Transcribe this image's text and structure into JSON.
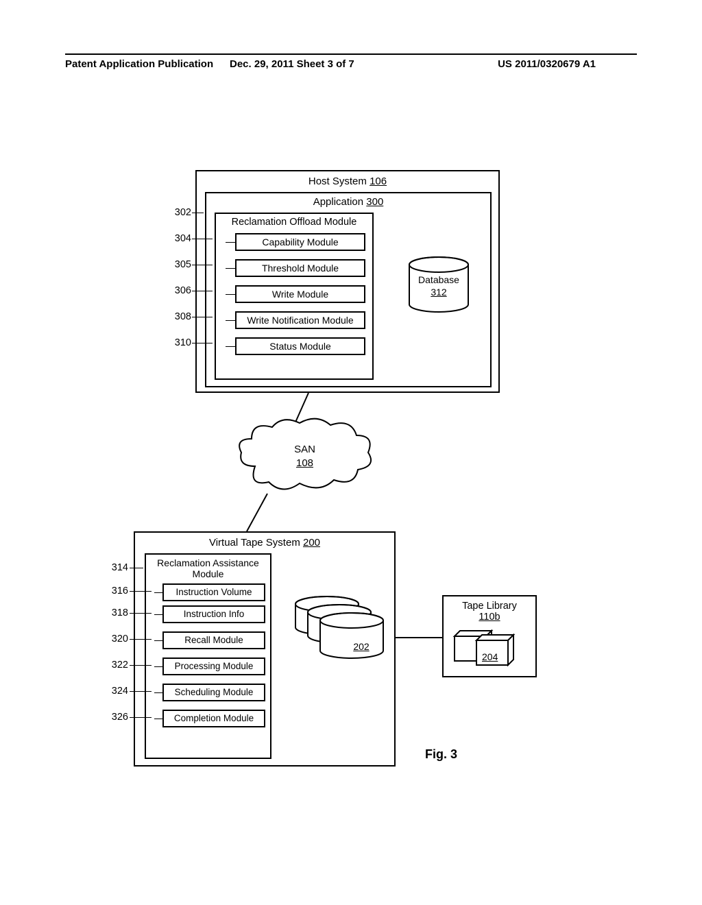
{
  "header": {
    "left": "Patent Application Publication",
    "center": "Dec. 29, 2011  Sheet 3 of 7",
    "right": "US 2011/0320679 A1"
  },
  "host": {
    "title": "Host System",
    "title_ref": "106",
    "app_title": "Application",
    "app_ref": "300",
    "offload_title": "Reclamation Offload Module",
    "offload_ref": "302",
    "modules": {
      "capability": {
        "label": "Capability Module",
        "ref": "304"
      },
      "threshold": {
        "label": "Threshold Module",
        "ref": "305"
      },
      "write": {
        "label": "Write Module",
        "ref": "306"
      },
      "write_notif": {
        "label": "Write Notification Module",
        "ref": "308"
      },
      "status": {
        "label": "Status Module",
        "ref": "310"
      }
    },
    "database": {
      "label": "Database",
      "ref": "312"
    }
  },
  "san": {
    "label": "SAN",
    "ref": "108"
  },
  "vt": {
    "title": "Virtual Tape System",
    "title_ref": "200",
    "ra_title": "Reclamation Assistance Module",
    "ra_ref": "314",
    "modules": {
      "instr_vol": {
        "label": "Instruction Volume",
        "ref": "316"
      },
      "instr_info": {
        "label": "Instruction Info",
        "ref": "318"
      },
      "recall": {
        "label": "Recall Module",
        "ref": "320"
      },
      "processing": {
        "label": "Processing Module",
        "ref": "322"
      },
      "scheduling": {
        "label": "Scheduling Module",
        "ref": "324"
      },
      "completion": {
        "label": "Completion Module",
        "ref": "326"
      }
    },
    "disk_ref": "202"
  },
  "tape_lib": {
    "label": "Tape Library",
    "ref": "110b",
    "cart_ref": "204"
  },
  "figure": "Fig. 3"
}
